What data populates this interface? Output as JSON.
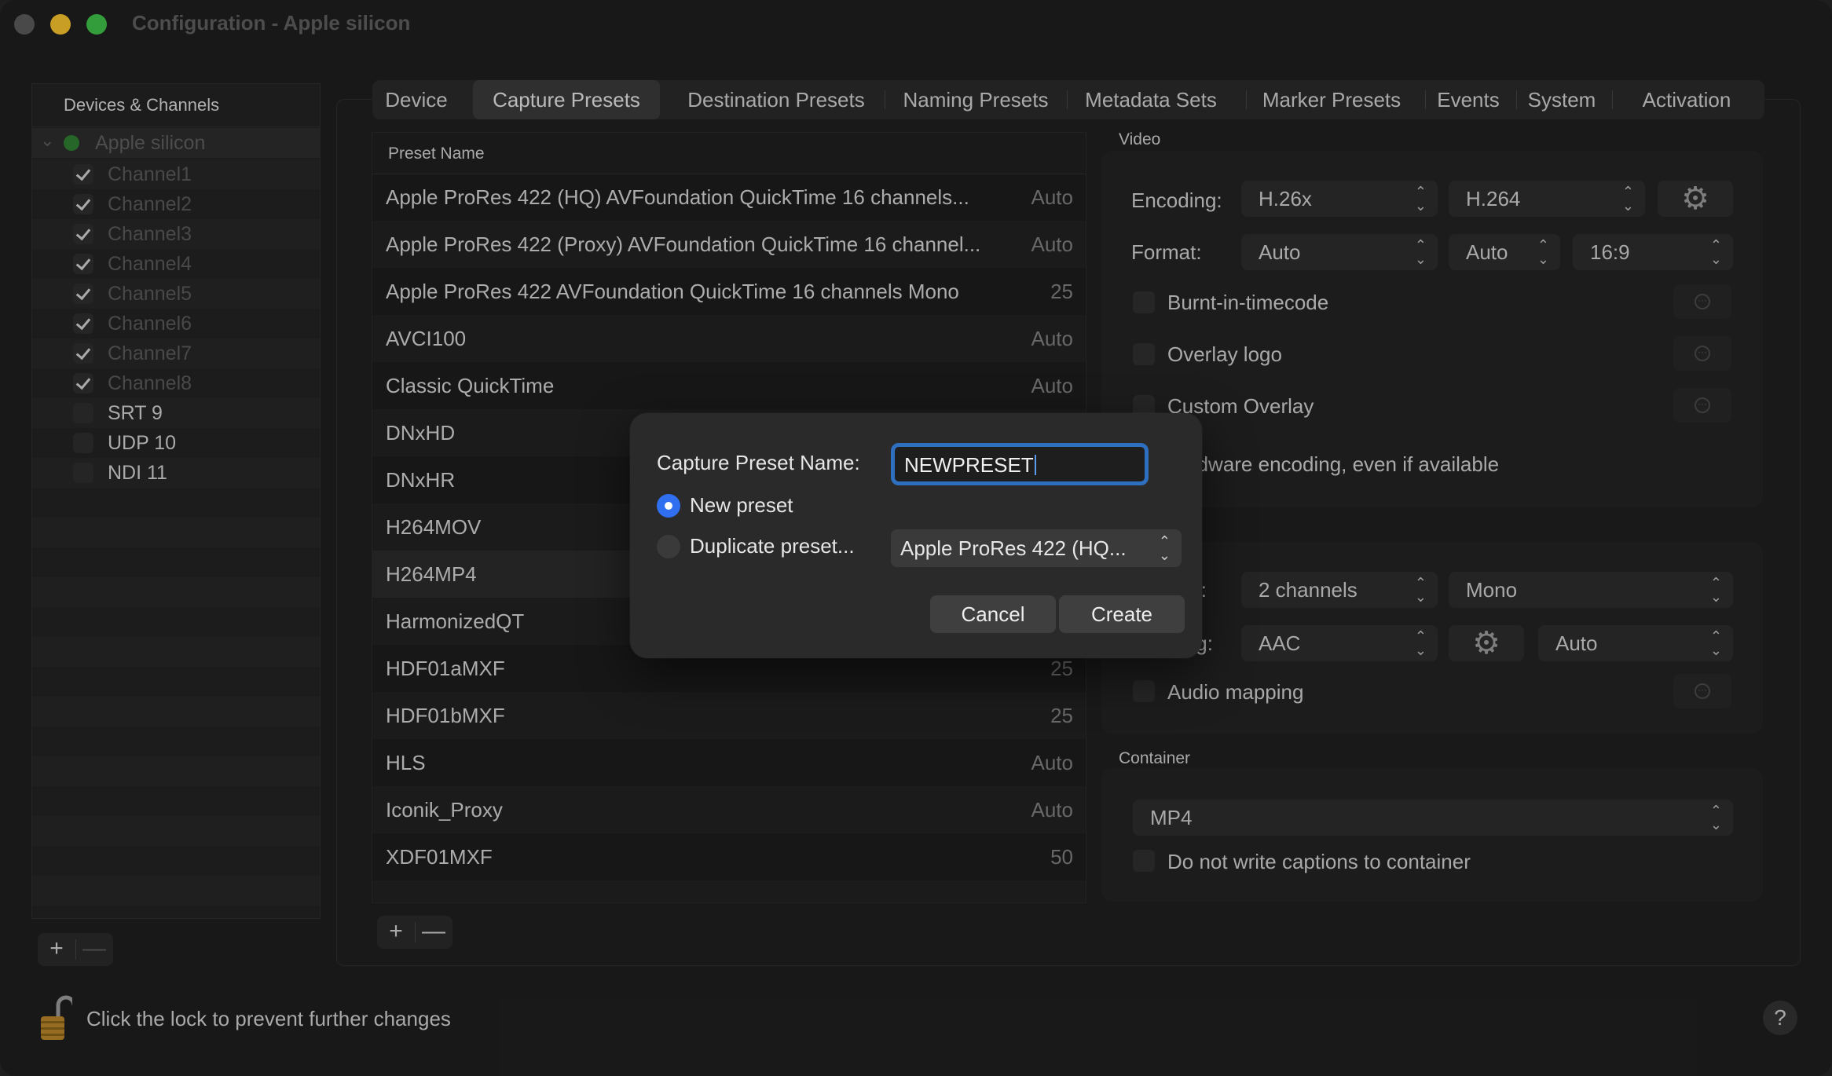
{
  "window": {
    "title": "Configuration - Apple silicon",
    "traffic_lights": {
      "close": "#5a5a5a",
      "minimize": "#f5c12e",
      "zoom": "#3fc04a"
    }
  },
  "sidebar": {
    "header": "Devices & Channels",
    "device": {
      "label": "Apple silicon",
      "status_color": "#2f7d32"
    },
    "channels": [
      {
        "label": "Channel1",
        "checked": true
      },
      {
        "label": "Channel2",
        "checked": true
      },
      {
        "label": "Channel3",
        "checked": true
      },
      {
        "label": "Channel4",
        "checked": true
      },
      {
        "label": "Channel5",
        "checked": true
      },
      {
        "label": "Channel6",
        "checked": true
      },
      {
        "label": "Channel7",
        "checked": true
      },
      {
        "label": "Channel8",
        "checked": true
      },
      {
        "label": "SRT 9",
        "checked": false
      },
      {
        "label": "UDP 10",
        "checked": false
      },
      {
        "label": "NDI 11",
        "checked": false
      }
    ],
    "add_label": "+",
    "remove_label": "—"
  },
  "tabs": [
    {
      "label": "Device",
      "active": false
    },
    {
      "label": "Capture Presets",
      "active": true
    },
    {
      "label": "Destination Presets",
      "active": false
    },
    {
      "label": "Naming Presets",
      "active": false
    },
    {
      "label": "Metadata Sets",
      "active": false
    },
    {
      "label": "Marker Presets",
      "active": false
    },
    {
      "label": "Events",
      "active": false
    },
    {
      "label": "System",
      "active": false
    },
    {
      "label": "Activation",
      "active": false
    }
  ],
  "presets": {
    "column_header": "Preset Name",
    "rows": [
      {
        "name": "Apple ProRes 422 (HQ) AVFoundation QuickTime 16 channels...",
        "value": "Auto"
      },
      {
        "name": "Apple ProRes 422 (Proxy) AVFoundation QuickTime 16 channel...",
        "value": "Auto"
      },
      {
        "name": "Apple ProRes 422 AVFoundation QuickTime 16 channels Mono",
        "value": "25"
      },
      {
        "name": "AVCI100",
        "value": "Auto"
      },
      {
        "name": "Classic QuickTime",
        "value": "Auto"
      },
      {
        "name": "DNxHD",
        "value": ""
      },
      {
        "name": "DNxHR",
        "value": ""
      },
      {
        "name": "H264MOV",
        "value": ""
      },
      {
        "name": "H264MP4",
        "value": ""
      },
      {
        "name": "HarmonizedQT",
        "value": ""
      },
      {
        "name": "HDF01aMXF",
        "value": "25"
      },
      {
        "name": "HDF01bMXF",
        "value": "25"
      },
      {
        "name": "HLS",
        "value": "Auto"
      },
      {
        "name": "Iconik_Proxy",
        "value": "Auto"
      },
      {
        "name": "XDF01MXF",
        "value": "50"
      }
    ],
    "add_label": "+",
    "remove_label": "—"
  },
  "video": {
    "group_label": "Video",
    "encoding_label": "Encoding:",
    "encoding_family": "H.26x",
    "encoding_codec": "H.264",
    "format_label": "Format:",
    "format_size": "Auto",
    "format_rate": "Auto",
    "format_aspect": "16:9",
    "burnt_in_timecode": "Burnt-in-timecode",
    "overlay_logo": "Overlay logo",
    "custom_overlay": "Custom Overlay",
    "hardware_encoding_partial": "hardware encoding, even if available"
  },
  "audio": {
    "channels_label_partial": "ls:",
    "channels_value": "2 channels",
    "mode_value": "Mono",
    "encoding_label_partial": "ing:",
    "encoding_value": "AAC",
    "rate_value": "Auto",
    "audio_mapping": "Audio mapping"
  },
  "container": {
    "group_label": "Container",
    "value": "MP4",
    "no_captions": "Do not write captions to container"
  },
  "footer": {
    "lock_text": "Click the lock to prevent further changes",
    "help_label": "?"
  },
  "dialog": {
    "name_label": "Capture Preset Name:",
    "name_value": "NEWPRESET",
    "new_preset_label": "New preset",
    "duplicate_label": "Duplicate preset...",
    "duplicate_source": "Apple ProRes 422 (HQ...",
    "cancel_label": "Cancel",
    "create_label": "Create",
    "accent_color": "#2f6ff0"
  }
}
